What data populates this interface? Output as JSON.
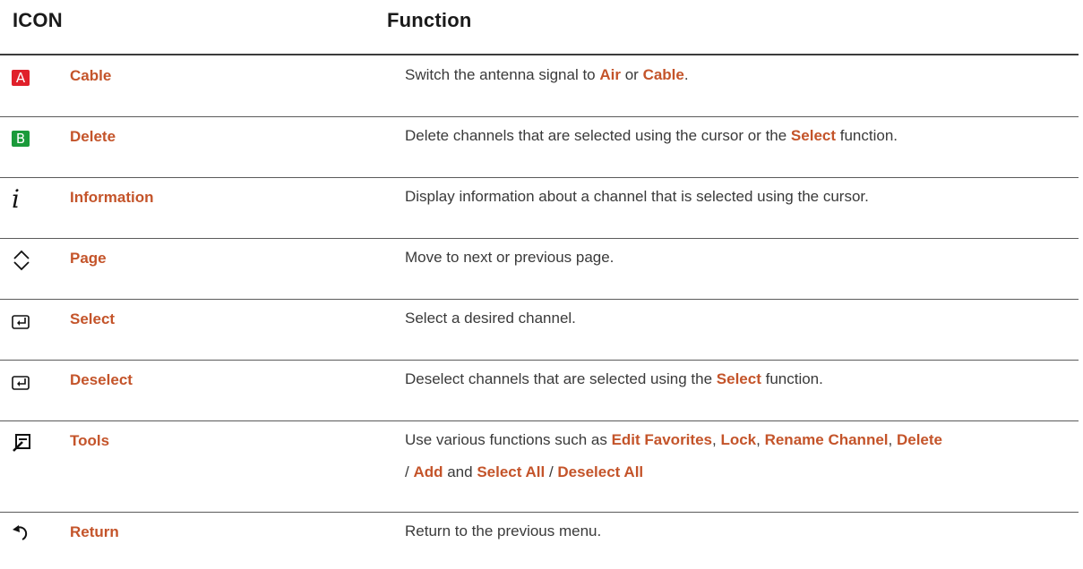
{
  "header": {
    "icon_col": "ICON",
    "function_col": "Function"
  },
  "colors": {
    "accent": "#c4542a",
    "red_button": "#e0202a",
    "green_button": "#1a9a3a"
  },
  "rows": [
    {
      "icon": "red-a-button-icon",
      "icon_text": "A",
      "name": "Cable",
      "desc": [
        "Switch the antenna signal to ",
        "Air",
        " or ",
        "Cable",
        "."
      ]
    },
    {
      "icon": "green-b-button-icon",
      "icon_text": "B",
      "name": "Delete",
      "desc": [
        "Delete channels that are selected using the cursor or the ",
        "Select",
        " function."
      ]
    },
    {
      "icon": "info-icon",
      "icon_text": "i",
      "name": "Information",
      "desc": [
        "Display information about a channel that is selected using the cursor."
      ]
    },
    {
      "icon": "page-up-down-icon",
      "name": "Page",
      "desc": [
        "Move to next or previous page."
      ]
    },
    {
      "icon": "enter-icon",
      "name": "Select",
      "desc": [
        "Select a desired channel."
      ]
    },
    {
      "icon": "enter-icon",
      "name": "Deselect",
      "desc": [
        "Deselect channels that are selected using the ",
        "Select",
        " function."
      ]
    },
    {
      "icon": "tools-icon",
      "name": "Tools",
      "desc": [
        "Use various functions such as ",
        "Edit Favorites",
        ", ",
        "Lock",
        ", ",
        "Rename Channel",
        ", ",
        "Delete",
        " / ",
        "Add",
        " and ",
        "Select All",
        " / ",
        "Deselect All"
      ]
    },
    {
      "icon": "return-icon",
      "name": "Return",
      "desc": [
        "Return to the previous menu."
      ]
    }
  ]
}
